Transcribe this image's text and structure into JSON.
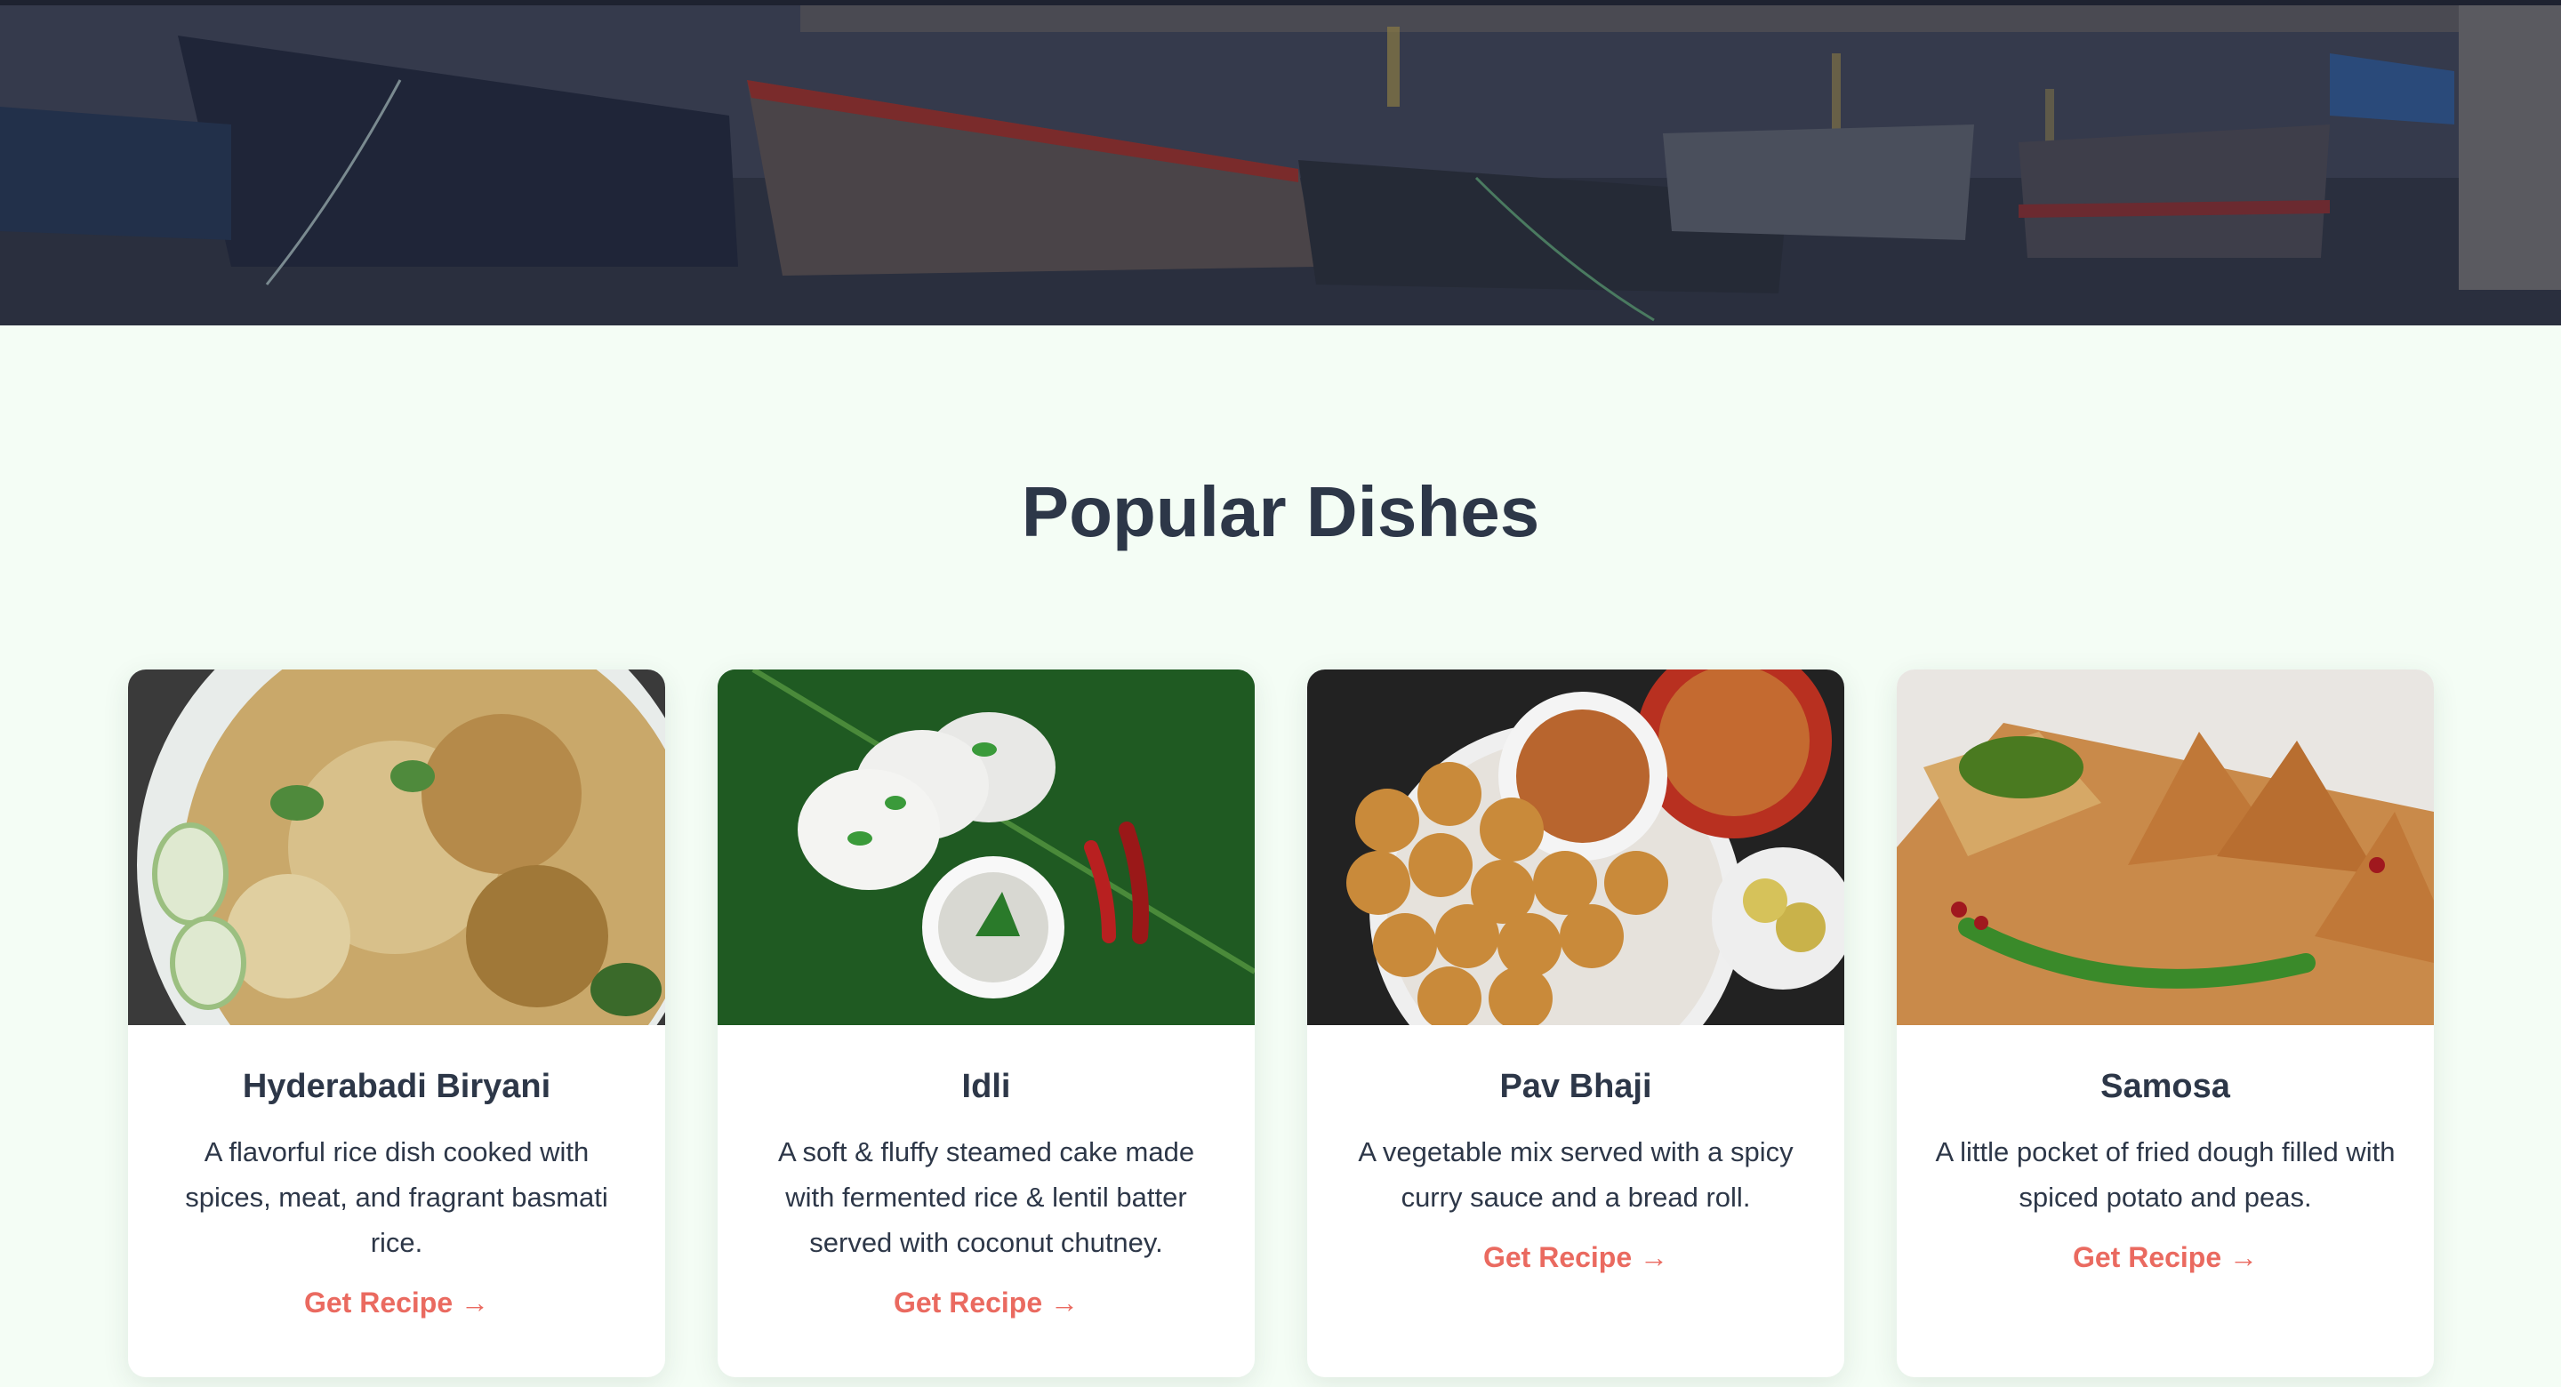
{
  "hero": {
    "icon": "boats-on-river-banner"
  },
  "section": {
    "title": "Popular Dishes"
  },
  "dishes": [
    {
      "name": "Hyderabadi Biryani",
      "description": "A flavorful rice dish cooked with spices, meat, and fragrant basmati rice.",
      "link_label": "Get Recipe →",
      "image": "biryani-plate-photo"
    },
    {
      "name": "Idli",
      "description": "A soft & fluffy steamed cake made with fermented rice & lentil batter served with coconut chutney.",
      "link_label": "Get Recipe →",
      "image": "idli-on-banana-leaf-photo"
    },
    {
      "name": "Pav Bhaji",
      "description": "A vegetable mix served with a spicy curry sauce and a bread roll.",
      "link_label": "Get Recipe →",
      "image": "pav-bhaji-plate-photo"
    },
    {
      "name": "Samosa",
      "description": "A little pocket of fried dough filled with spiced potato and peas.",
      "link_label": "Get Recipe →",
      "image": "samosa-board-photo"
    }
  ],
  "colors": {
    "background": "#f4fdf5",
    "heading": "#2d3748",
    "link": "#ea6a60",
    "card": "#ffffff"
  }
}
